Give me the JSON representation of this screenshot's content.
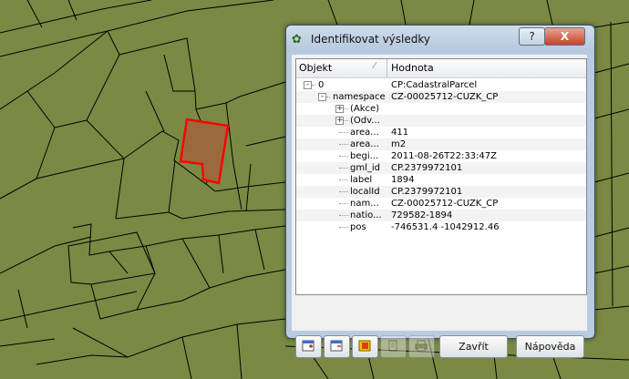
{
  "dialog": {
    "title": "Identifikovat výsledky",
    "help_label": "?",
    "close_label": "X",
    "columns": {
      "object": "Objekt",
      "value": "Hodnota"
    },
    "rows": [
      {
        "name": "0",
        "value": "CP:CadastralParcel",
        "expander": "-"
      },
      {
        "name": "namespace",
        "value": "CZ-00025712-CUZK_CP",
        "expander": "-"
      },
      {
        "name": "(Akce)",
        "value": "",
        "expander": "+"
      },
      {
        "name": "(Odv...",
        "value": "",
        "expander": "+"
      },
      {
        "name": "area...",
        "value": "411",
        "expander": ""
      },
      {
        "name": "area...",
        "value": "m2",
        "expander": ""
      },
      {
        "name": "begi...",
        "value": "2011-08-26T22:33:47Z",
        "expander": ""
      },
      {
        "name": "gml_id",
        "value": "CP.2379972101",
        "expander": ""
      },
      {
        "name": "label",
        "value": "1894",
        "expander": ""
      },
      {
        "name": "localId",
        "value": "CP.2379972101",
        "expander": ""
      },
      {
        "name": "nam...",
        "value": "CZ-00025712-CUZK_CP",
        "expander": ""
      },
      {
        "name": "natio...",
        "value": "729582-1894",
        "expander": ""
      },
      {
        "name": "pos",
        "value": "-746531.4 -1042912.46",
        "expander": ""
      }
    ],
    "buttons": {
      "close": "Zavřít",
      "help": "Nápověda"
    },
    "toolbar_icons": [
      "expand-tree-icon",
      "collapse-tree-icon",
      "highlight-icon",
      "copy-icon",
      "print-icon"
    ]
  },
  "map": {
    "background_color": "#7a8a44",
    "highlight_color": "#ff0000"
  }
}
